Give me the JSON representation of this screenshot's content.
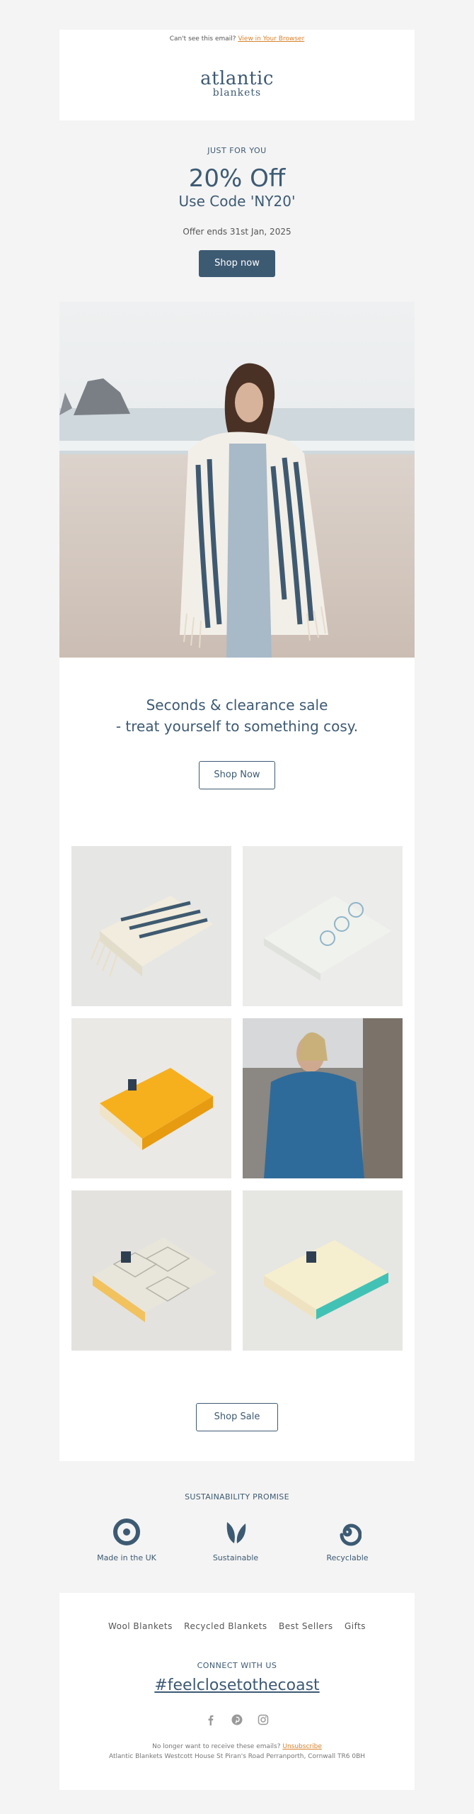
{
  "preheader": {
    "text": "Can't see this email?",
    "link": "View in Your Browser"
  },
  "logo": {
    "line1": "atlantic",
    "line2": "blankets"
  },
  "promo": {
    "eyebrow": "JUST FOR YOU",
    "headline": "20% Off",
    "code": "Use Code 'NY20'",
    "ends": "Offer ends 31st Jan, 2025",
    "button": "Shop now"
  },
  "sale": {
    "title_line1": "Seconds & clearance sale",
    "title_line2": "- treat yourself to something cosy.",
    "button": "Shop Now",
    "bottom_button": "Shop Sale"
  },
  "sustainability": {
    "title": "SUSTAINABILITY PROMISE",
    "items": [
      {
        "label": "Made in the UK",
        "icon": "target-icon"
      },
      {
        "label": "Sustainable",
        "icon": "leaf-icon"
      },
      {
        "label": "Recyclable",
        "icon": "spiral-icon"
      }
    ]
  },
  "footer": {
    "nav": [
      "Wool Blankets",
      "Recycled Blankets",
      "Best Sellers",
      "Gifts"
    ],
    "connect": "CONNECT WITH US",
    "hashtag": "#feelclosetothecoast",
    "social": [
      "facebook-icon",
      "pinterest-icon",
      "instagram-icon"
    ],
    "unsubscribe_text": "No longer want to receive these emails?",
    "unsubscribe_link": "Unsubscribe",
    "address": "Atlantic Blankets Westcott House St Piran's Road Perranporth, Cornwall TR6 0BH"
  },
  "colors": {
    "brand": "#3d5a73",
    "link": "#d9822b",
    "background": "#f4f4f4"
  }
}
